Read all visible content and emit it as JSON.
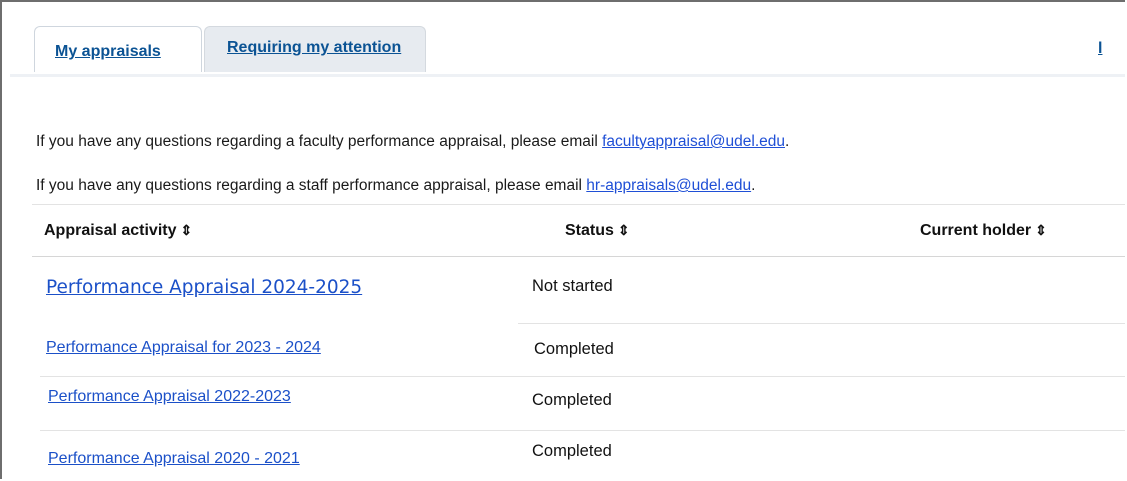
{
  "tabs": [
    {
      "label": "My appraisals",
      "active": true
    },
    {
      "label": "Requiring my attention",
      "active": false
    }
  ],
  "tab_edge_fragment": "l",
  "info_lines": [
    {
      "text": "If you have any questions regarding a faculty performance appraisal, please email ",
      "email": "facultyappraisal@udel.edu",
      "suffix": "."
    },
    {
      "text": "If you have any questions regarding a staff performance appraisal, please email ",
      "email": "hr-appraisals@udel.edu",
      "suffix": "."
    }
  ],
  "table": {
    "headers": {
      "activity": "Appraisal activity",
      "status": "Status",
      "holder": "Current holder",
      "sort_glyph": "⇕"
    },
    "rows": [
      {
        "activity": "Performance Appraisal 2024-2025",
        "status": "Not started",
        "holder": ""
      },
      {
        "activity": "Performance Appraisal for 2023 - 2024",
        "status": "Completed",
        "holder": ""
      },
      {
        "activity": "Performance Appraisal  2022-2023",
        "status": "Completed",
        "holder": ""
      },
      {
        "activity": "Performance Appraisal 2020 - 2021",
        "status": "Completed",
        "holder": ""
      }
    ]
  },
  "colors": {
    "link": "#1b50c8",
    "tab_link": "#0b5394",
    "inactive_tab_bg": "#e7ebf0"
  }
}
